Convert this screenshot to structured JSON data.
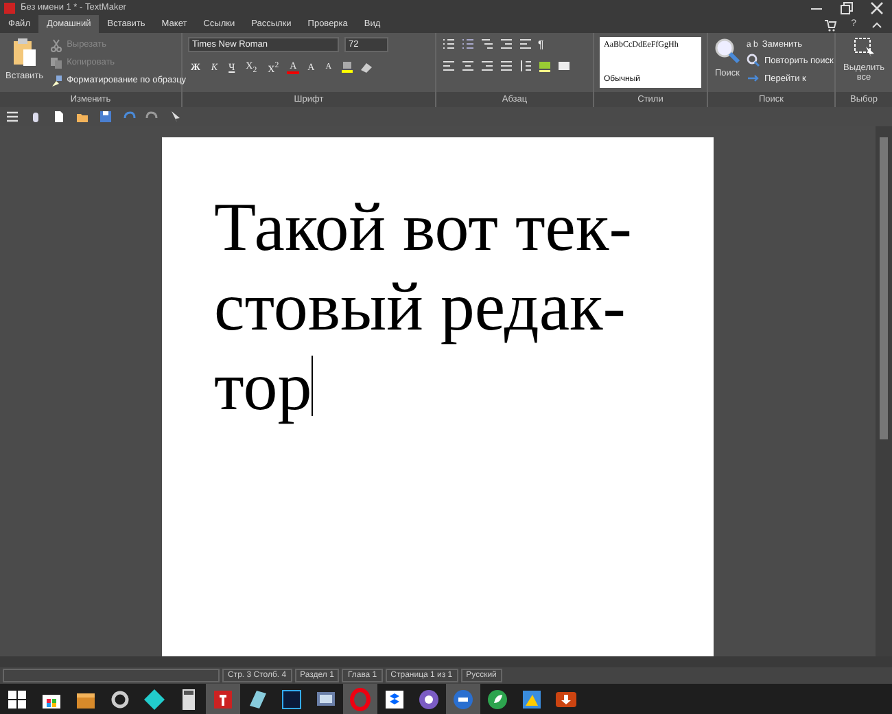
{
  "window": {
    "title": "Без имени 1 * - TextMaker",
    "help": "?"
  },
  "tabs": [
    {
      "label": "Файл",
      "selected": false
    },
    {
      "label": "Домашний",
      "selected": true
    },
    {
      "label": "Вставить",
      "selected": false
    },
    {
      "label": "Макет",
      "selected": false
    },
    {
      "label": "Ссылки",
      "selected": false
    },
    {
      "label": "Рассылки",
      "selected": false
    },
    {
      "label": "Проверка",
      "selected": false
    },
    {
      "label": "Вид",
      "selected": false
    }
  ],
  "ribbon": {
    "clipboard": {
      "label": "Изменить",
      "paste": "Вставить",
      "items": [
        {
          "label": "Вырезать",
          "kind": "cut",
          "disabled": true
        },
        {
          "label": "Копировать",
          "kind": "copy",
          "disabled": true
        },
        {
          "label": "Форматирование по образцу",
          "kind": "brush",
          "disabled": false
        }
      ]
    },
    "font": {
      "label": "Шрифт",
      "family": "Times New Roman",
      "size": "72",
      "buttons": [
        {
          "label": "Ж",
          "kind": "bold"
        },
        {
          "label": "К",
          "kind": "italic"
        },
        {
          "label": "Ч",
          "kind": "underline"
        },
        {
          "label": "X$_{2}$",
          "kind": "plain"
        },
        {
          "label": "X$^{2}$",
          "kind": "plain"
        },
        {
          "label": "A",
          "kind": "color"
        },
        {
          "label": "A",
          "kind": "grow"
        },
        {
          "label": "A",
          "kind": "shrink"
        }
      ]
    },
    "paragraph": {
      "label": "Абзац",
      "pilcrow": "¶"
    },
    "styles": {
      "label": "Стили",
      "sample": "AaBbCcDdEeFfGgHh",
      "style": "Обычный"
    },
    "search": {
      "label": "Поиск",
      "find": "Поиск",
      "replace_glyph": "a b",
      "items": [
        {
          "label": "Заменить",
          "kind": "replace"
        },
        {
          "label": "Повторить поиск",
          "kind": "repeat"
        },
        {
          "label": "Перейти к",
          "kind": "goto"
        }
      ]
    },
    "select": {
      "label": "Выбор",
      "button": "Выделить все"
    }
  },
  "document": {
    "lines": [
      {
        "text": "Такой вот тек-",
        "caret": false
      },
      {
        "text": "стовый редак-",
        "caret": false
      },
      {
        "text": "тор",
        "caret": true
      }
    ]
  },
  "status_bar": [
    "Стр. 3 Столб. 4",
    "Раздел 1",
    "Глава 1",
    "Страница 1 из 1",
    "Русский"
  ],
  "taskbar": [
    {
      "kind": "windows",
      "active": false
    },
    {
      "kind": "store",
      "active": false
    },
    {
      "kind": "box",
      "active": false
    },
    {
      "kind": "gear",
      "active": false
    },
    {
      "kind": "diamond",
      "active": false
    },
    {
      "kind": "calc",
      "active": false
    },
    {
      "kind": "textmaker",
      "active": true
    },
    {
      "kind": "sheet",
      "active": false
    },
    {
      "kind": "ps",
      "active": false
    },
    {
      "kind": "monitor",
      "active": false
    },
    {
      "kind": "opera",
      "active": true
    },
    {
      "kind": "dropbox",
      "active": false
    },
    {
      "kind": "viber",
      "active": false
    },
    {
      "kind": "chat",
      "active": true
    },
    {
      "kind": "leaf",
      "active": false
    },
    {
      "kind": "map",
      "active": false
    },
    {
      "kind": "download",
      "active": false
    }
  ]
}
